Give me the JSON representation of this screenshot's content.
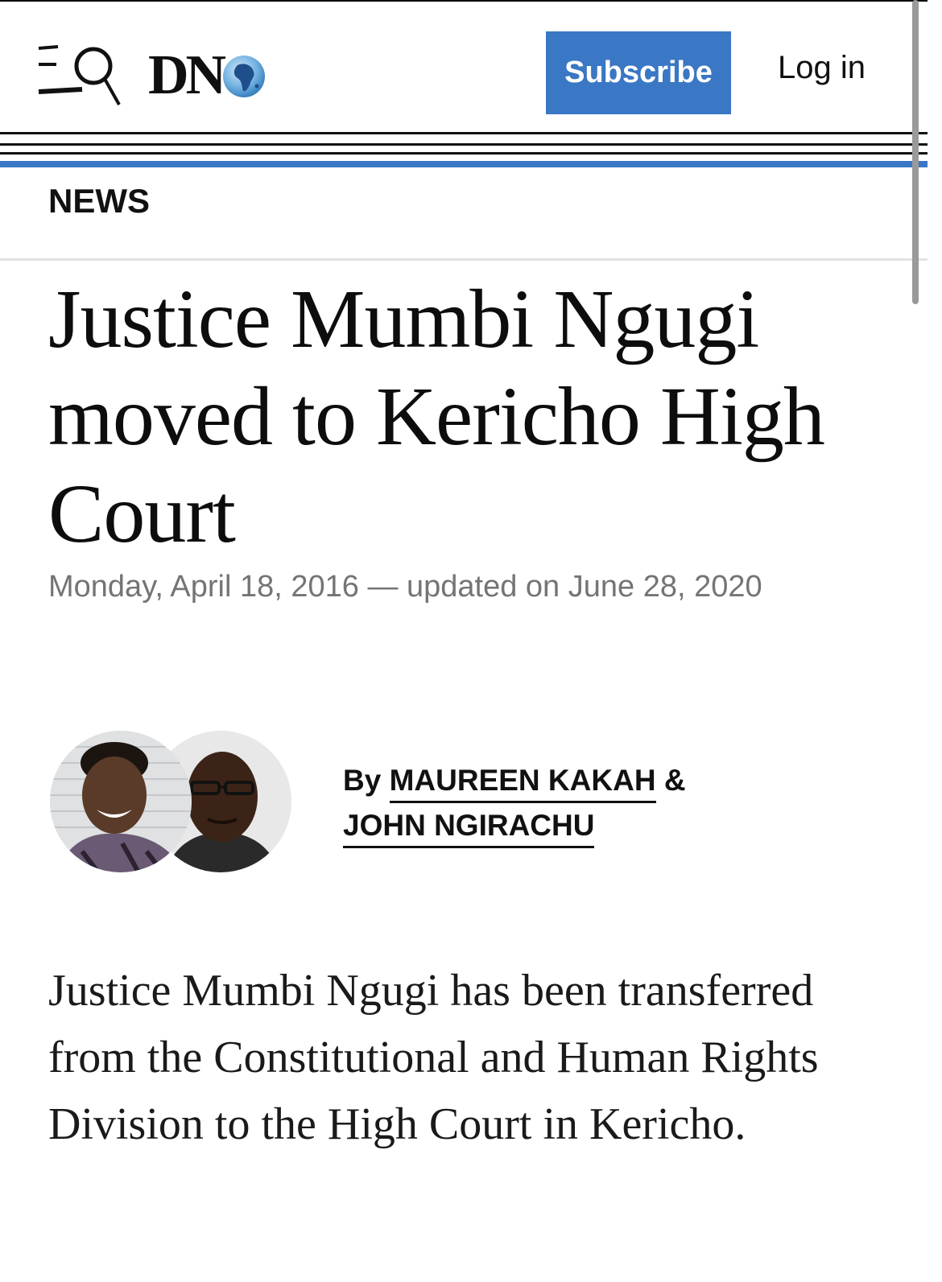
{
  "header": {
    "logo_text": "DN",
    "subscribe_label": "Subscribe",
    "login_label": "Log in",
    "icons": [
      "menu-search-icon",
      "globe-icon"
    ],
    "accent_color": "#3a77c4"
  },
  "section": {
    "label": "NEWS"
  },
  "article": {
    "headline": "Justice Mumbi Ngugi moved to Kericho High Court",
    "dateline": "Monday, April 18, 2016 — updated on June 28, 2020",
    "byline_prefix": "By",
    "author_1": "MAUREEN KAKAH",
    "connector": "&",
    "author_2": "JOHN NGIRACHU",
    "lead": "Justice Mumbi Ngugi has been transferred from the Constitutional and Human Rights Division to the High Court in Kericho."
  }
}
